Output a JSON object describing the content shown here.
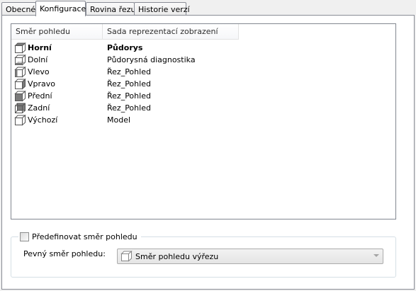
{
  "tabs": [
    {
      "label": "Obecné",
      "active": false
    },
    {
      "label": "Konfigurace",
      "active": true
    },
    {
      "label": "Rovina řezu",
      "active": false
    },
    {
      "label": "Historie verzí",
      "active": false
    }
  ],
  "list": {
    "columns": [
      "Směr pohledu",
      "Sada reprezentací zobrazení"
    ],
    "rows": [
      {
        "direction": "Horní",
        "set": "Půdorys",
        "icon": "view-top-icon",
        "bold": true
      },
      {
        "direction": "Dolní",
        "set": "Půdorysná diagnostika",
        "icon": "view-bottom-icon",
        "bold": false
      },
      {
        "direction": "Vlevo",
        "set": "Řez_Pohled",
        "icon": "view-left-icon",
        "bold": false
      },
      {
        "direction": "Vpravo",
        "set": "Řez_Pohled",
        "icon": "view-right-icon",
        "bold": false
      },
      {
        "direction": "Přední",
        "set": "Řez_Pohled",
        "icon": "view-front-icon",
        "bold": false
      },
      {
        "direction": "Zadní",
        "set": "Řez_Pohled",
        "icon": "view-back-icon",
        "bold": false
      },
      {
        "direction": "Výchozí",
        "set": "Model",
        "icon": "view-default-icon",
        "bold": false
      }
    ]
  },
  "override": {
    "checkbox_label": "Předefinovat směr pohledu",
    "checked": false,
    "fixed_label": "Pevný směr pohledu:",
    "combo_value": "Směr pohledu výřezu",
    "combo_icon": "view-cube-icon"
  }
}
